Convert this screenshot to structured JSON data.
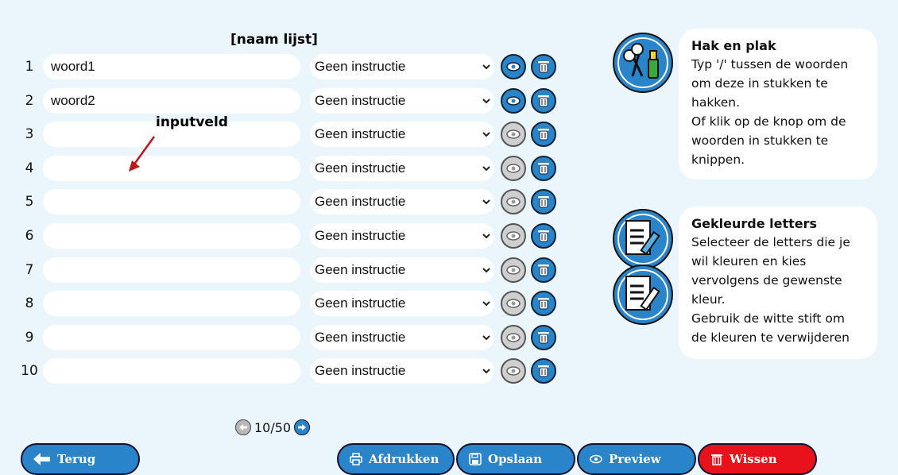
{
  "list_title": "[naam lijst]",
  "instruction_default": "Geen instructie",
  "rows": [
    {
      "num": "1",
      "word": "woord1",
      "eye": "on"
    },
    {
      "num": "2",
      "word": "woord2",
      "eye": "on"
    },
    {
      "num": "3",
      "word": "",
      "eye": "off"
    },
    {
      "num": "4",
      "word": "",
      "eye": "off"
    },
    {
      "num": "5",
      "word": "",
      "eye": "off"
    },
    {
      "num": "6",
      "word": "",
      "eye": "off"
    },
    {
      "num": "7",
      "word": "",
      "eye": "off"
    },
    {
      "num": "8",
      "word": "",
      "eye": "off"
    },
    {
      "num": "9",
      "word": "",
      "eye": "off"
    },
    {
      "num": "10",
      "word": "",
      "eye": "off"
    }
  ],
  "annotation": "inputveld",
  "pager": {
    "text": "10/50"
  },
  "help": {
    "cut": {
      "title": "Hak en plak",
      "lines": [
        "Typ '/' tussen de woorden",
        "om deze in stukken te",
        "hakken.",
        "Of klik op de knop om de",
        "woorden in stukken te",
        "knippen."
      ]
    },
    "color": {
      "title": "Gekleurde letters",
      "lines": [
        "Selecteer de letters die je",
        "wil kleuren en kies",
        "vervolgens de gewenste",
        "kleur.",
        "Gebruik de witte stift om",
        "de kleuren te verwijderen"
      ]
    }
  },
  "buttons": {
    "back": "Terug",
    "print": "Afdrukken",
    "save": "Opslaan",
    "preview": "Preview",
    "clear": "Wissen"
  },
  "icons": {
    "back": "arrow-left-icon",
    "print": "printer-icon",
    "save": "floppy-disk-icon",
    "preview": "eye-icon",
    "clear": "trash-icon"
  },
  "colors": {
    "accent": "#2a84c9",
    "danger": "#e8131a",
    "background": "#eaf6fb"
  }
}
